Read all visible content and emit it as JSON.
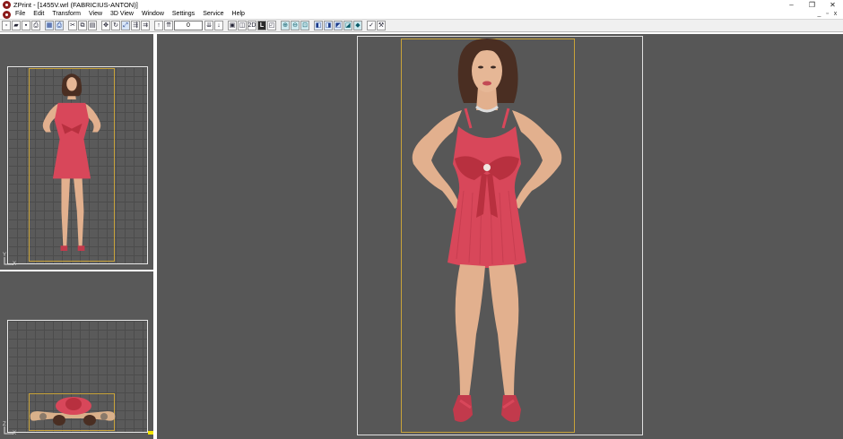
{
  "window": {
    "title": "ZPrint - [1455V.wrl (FABRICIUS-ANTON)]",
    "controls": {
      "minimize": "–",
      "restore": "❐",
      "close": "✕"
    }
  },
  "menu": {
    "items": [
      "File",
      "Edit",
      "Transform",
      "View",
      "3D View",
      "Window",
      "Settings",
      "Service",
      "Help"
    ],
    "mdi_controls": {
      "minimize": "_",
      "restore": "▫",
      "close": "x"
    }
  },
  "toolbar": {
    "value_field": "0",
    "label_2d": "2D",
    "label_l": "L"
  },
  "viewports": {
    "front": {
      "axis_y": "Y",
      "axis_x": "X"
    },
    "top": {
      "axis_y": "Z",
      "axis_x": "X"
    }
  },
  "colors": {
    "viewport_bg": "#595959",
    "bbox": "#c8a33a",
    "dress": "#d8475a",
    "skin": "#e2b08e",
    "hair": "#4a2e22",
    "marker": "#f2e400"
  }
}
